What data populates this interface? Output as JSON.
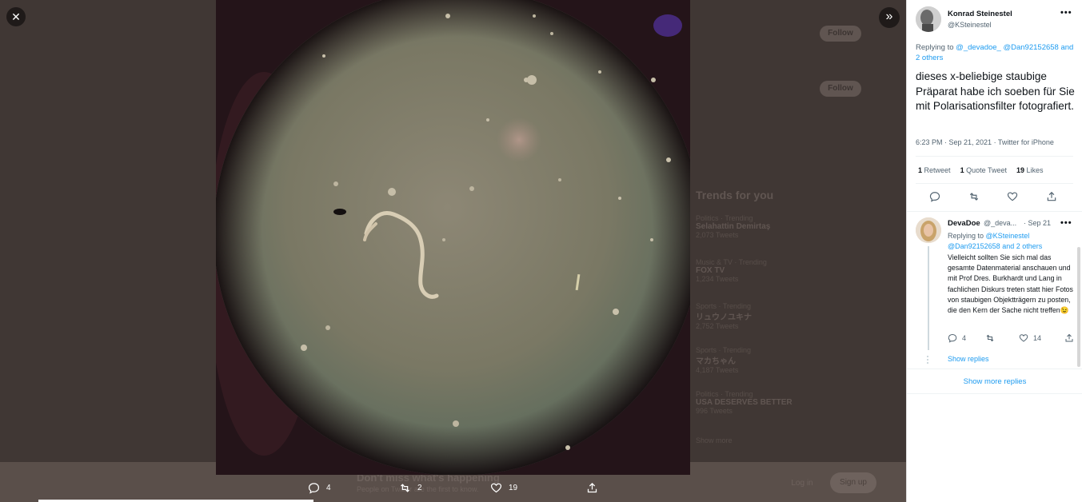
{
  "lightbox": {
    "close_icon": "close-icon",
    "expand_icon": "chevrons-right-icon",
    "actions": {
      "reply_count": "4",
      "retweet_count": "2",
      "like_count": "19"
    }
  },
  "background_page": {
    "follow_label": "Follow",
    "trends_title": "Trends for you",
    "trends": [
      {
        "context": "Politics · Trending",
        "name": "Selahattin Demirtaş",
        "count": "2,073 Tweets"
      },
      {
        "context": "Music & TV · Trending",
        "name": "FOX TV",
        "count": "1,234 Tweets"
      },
      {
        "context": "Sports · Trending",
        "name": "リュウノユキナ",
        "count": "2,752 Tweets"
      },
      {
        "context": "Sports · Trending",
        "name": "マカちゃん",
        "count": "4,187 Tweets"
      },
      {
        "context": "Politics · Trending",
        "name": "USA DESERVES BETTER",
        "count": "996 Tweets"
      }
    ],
    "show_more": "Show more",
    "bottom_title": "Don't miss what's happening",
    "bottom_sub": "People on Twitter are the first to know.",
    "login": "Log in",
    "signup": "Sign up"
  },
  "tweet": {
    "author_name": "Konrad Steinestel",
    "author_handle": "@KSteinestel",
    "replying_prefix": "Replying to",
    "replying_handle_1": "@_devadoe_",
    "replying_handle_2": "@Dan92152658",
    "replying_suffix": "and 2 others",
    "text": "dieses x-beliebige staubige Präparat habe ich soeben für Sie mit Polarisationsfilter fotografiert.",
    "meta": "6:23 PM · Sep 21, 2021 · Twitter for iPhone",
    "retweets_count": "1",
    "retweets_label": "Retweet",
    "quote_count": "1",
    "quote_label": "Quote Tweet",
    "likes_count": "19",
    "likes_label": "Likes"
  },
  "reply": {
    "name": "DevaDoe",
    "handle": "@_deva...",
    "date": "· Sep 21",
    "replying_prefix": "Replying to",
    "replying_handle_1": "@KSteinestel",
    "replying_handle_2": "@Dan92152658",
    "replying_suffix": "and 2 others",
    "text": "Vielleicht sollten Sie sich mal das gesamte Datenmaterial anschauen und mit Prof Dres. Burkhardt und Lang in fachlichen Diskurs treten statt hier Fotos von staubigen Objektträgern zu posten, die den Kern der Sache nicht treffen😉",
    "reply_count": "4",
    "like_count": "14",
    "show_replies": "Show replies"
  },
  "show_more_replies": "Show more replies"
}
